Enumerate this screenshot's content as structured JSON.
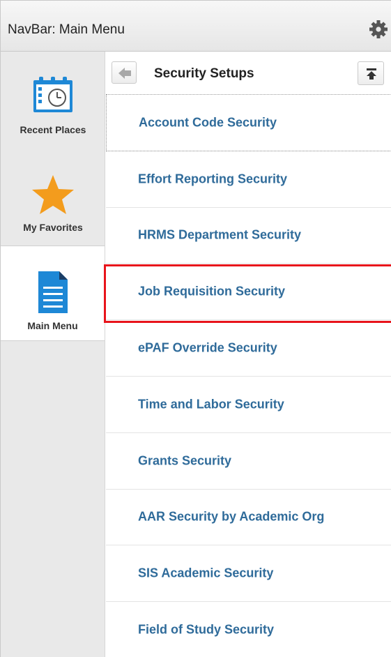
{
  "header": {
    "title": "NavBar: Main Menu",
    "settings_icon": "gear-icon"
  },
  "leftnav": {
    "items": [
      {
        "label": "Recent Places",
        "icon": "calendar-clock-icon",
        "selected": false
      },
      {
        "label": "My Favorites",
        "icon": "star-icon",
        "selected": false
      },
      {
        "label": "Main Menu",
        "icon": "document-icon",
        "selected": true
      }
    ]
  },
  "panel": {
    "title": "Security Setups",
    "back_icon": "back-arrow-icon",
    "top_icon": "scroll-top-icon",
    "items": [
      {
        "label": "Account Code Security"
      },
      {
        "label": "Effort Reporting Security"
      },
      {
        "label": "HRMS Department Security"
      },
      {
        "label": "Job Requisition Security",
        "highlighted": true
      },
      {
        "label": "ePAF Override Security"
      },
      {
        "label": "Time and Labor Security"
      },
      {
        "label": "Grants Security"
      },
      {
        "label": "AAR Security by Academic Org"
      },
      {
        "label": "SIS Academic Security"
      },
      {
        "label": "Field of Study Security"
      }
    ]
  },
  "colors": {
    "link": "#2f6b9a",
    "highlight_border": "#e8141b",
    "nav_background": "#e9e9e9",
    "icon_blue": "#1e88d6",
    "star_orange": "#f39c1d"
  }
}
